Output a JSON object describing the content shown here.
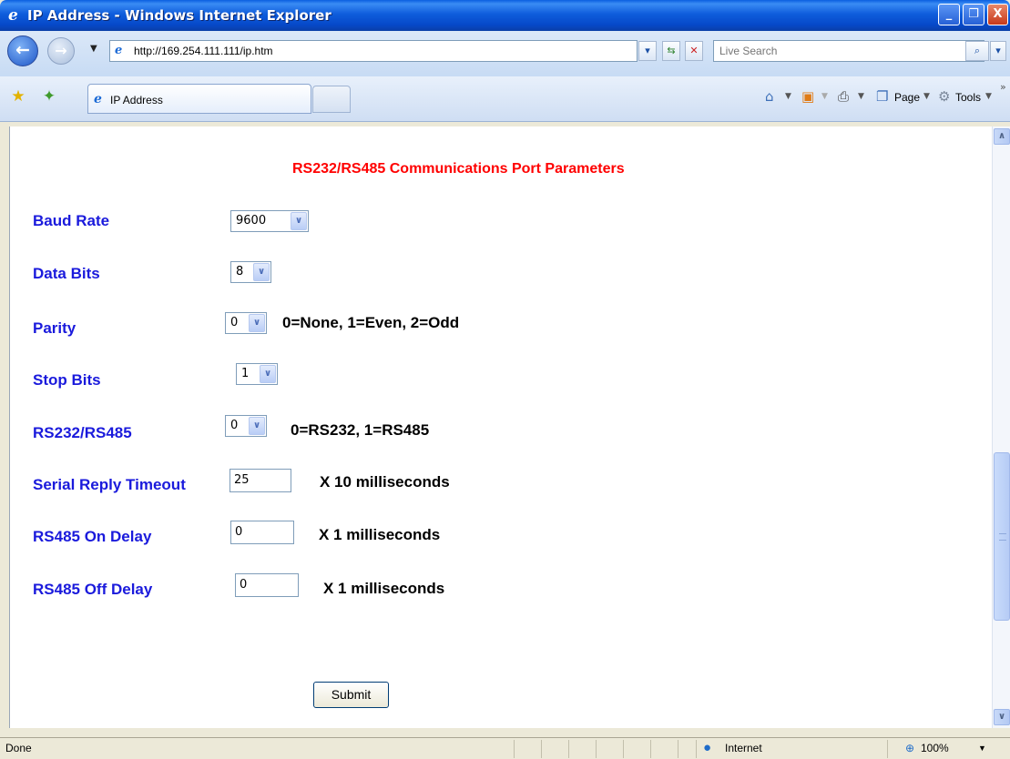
{
  "window": {
    "title": "IP Address - Windows Internet Explorer",
    "minimize": "_",
    "restore": "❐",
    "close": "X"
  },
  "address": {
    "url": "http://169.254.111.111/ip.htm",
    "search_placeholder": "Live Search"
  },
  "tab": {
    "label": "IP Address"
  },
  "commands": {
    "page": "Page",
    "tools": "Tools"
  },
  "page": {
    "heading": "RS232/RS485 Communications Port Parameters",
    "baud_rate": {
      "label": "Baud Rate",
      "value": "9600"
    },
    "data_bits": {
      "label": "Data Bits",
      "value": "8"
    },
    "parity": {
      "label": "Parity",
      "value": "0",
      "note": "0=None, 1=Even, 2=Odd"
    },
    "stop_bits": {
      "label": "Stop Bits",
      "value": "1"
    },
    "mode": {
      "label": "RS232/RS485",
      "value": "0",
      "note": "0=RS232,  1=RS485"
    },
    "serial_timeout": {
      "label": "Serial Reply Timeout",
      "value": "25",
      "note": "X 10 milliseconds"
    },
    "on_delay": {
      "label": "RS485 On Delay",
      "value": "0",
      "note": "X 1 milliseconds"
    },
    "off_delay": {
      "label": "RS485 Off Delay",
      "value": "0",
      "note": "X 1 milliseconds"
    },
    "submit_label": "Submit"
  },
  "status": {
    "text": "Done",
    "zone": "Internet",
    "zoom": "100%"
  }
}
